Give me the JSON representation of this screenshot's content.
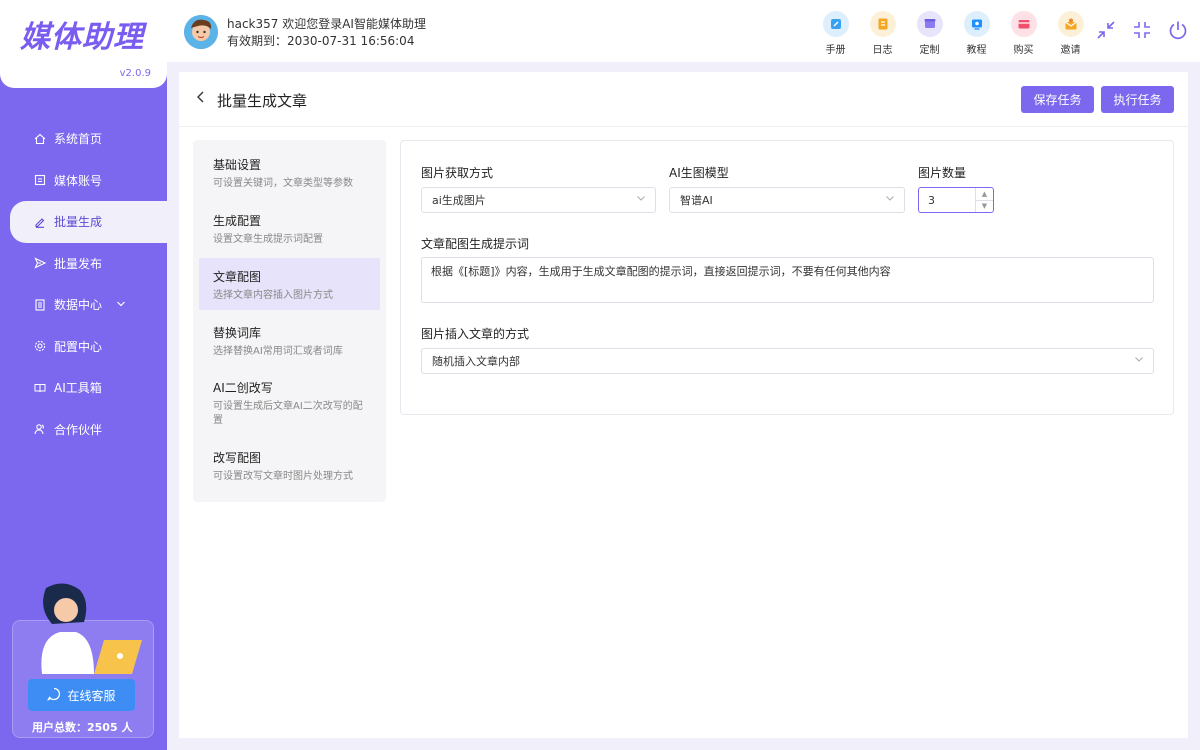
{
  "app": {
    "logo": "媒体助理",
    "version": "v2.0.9"
  },
  "sidebar": {
    "items": [
      {
        "label": "系统首页",
        "icon": "home-icon"
      },
      {
        "label": "媒体账号",
        "icon": "account-icon"
      },
      {
        "label": "批量生成",
        "icon": "edit-icon",
        "active": true
      },
      {
        "label": "批量发布",
        "icon": "send-icon"
      },
      {
        "label": "数据中心",
        "icon": "data-icon"
      },
      {
        "label": "配置中心",
        "icon": "settings-icon"
      },
      {
        "label": "AI工具箱",
        "icon": "book-icon"
      },
      {
        "label": "合作伙伴",
        "icon": "partner-icon"
      }
    ],
    "support_button": "在线客服",
    "user_count": "用户总数：2505 人"
  },
  "header": {
    "user_line": "hack357 欢迎您登录AI智能媒体助理",
    "expiry_line": "有效期到：2030-07-31 16:56:04",
    "top_buttons": [
      {
        "label": "手册",
        "color": "#3aa0f0"
      },
      {
        "label": "日志",
        "color": "#f5a623"
      },
      {
        "label": "定制",
        "color": "#8a7cf0"
      },
      {
        "label": "教程",
        "color": "#1e90ff"
      },
      {
        "label": "购买",
        "color": "#f0506e"
      },
      {
        "label": "邀请",
        "color": "#f5a623"
      }
    ]
  },
  "page": {
    "title": "批量生成文章",
    "save_button": "保存任务",
    "run_button": "执行任务"
  },
  "steps": [
    {
      "title": "基础设置",
      "desc": "可设置关键词，文章类型等参数"
    },
    {
      "title": "生成配置",
      "desc": "设置文章生成提示词配置"
    },
    {
      "title": "文章配图",
      "desc": "选择文章内容插入图片方式",
      "active": true
    },
    {
      "title": "替换词库",
      "desc": "选择替换AI常用词汇或者词库"
    },
    {
      "title": "AI二创改写",
      "desc": "可设置生成后文章AI二次改写的配置"
    },
    {
      "title": "改写配图",
      "desc": "可设置改写文章时图片处理方式"
    }
  ],
  "form": {
    "image_source_label": "图片获取方式",
    "image_source_value": "ai生成图片",
    "model_label": "AI生图模型",
    "model_value": "智谱AI",
    "count_label": "图片数量",
    "count_value": "3",
    "prompt_label": "文章配图生成提示词",
    "prompt_value": "根据《[标题]》内容，生成用于生成文章配图的提示词，直接返回提示词，不要有任何其他内容",
    "insert_label": "图片插入文章的方式",
    "insert_value": "随机插入文章内部"
  }
}
